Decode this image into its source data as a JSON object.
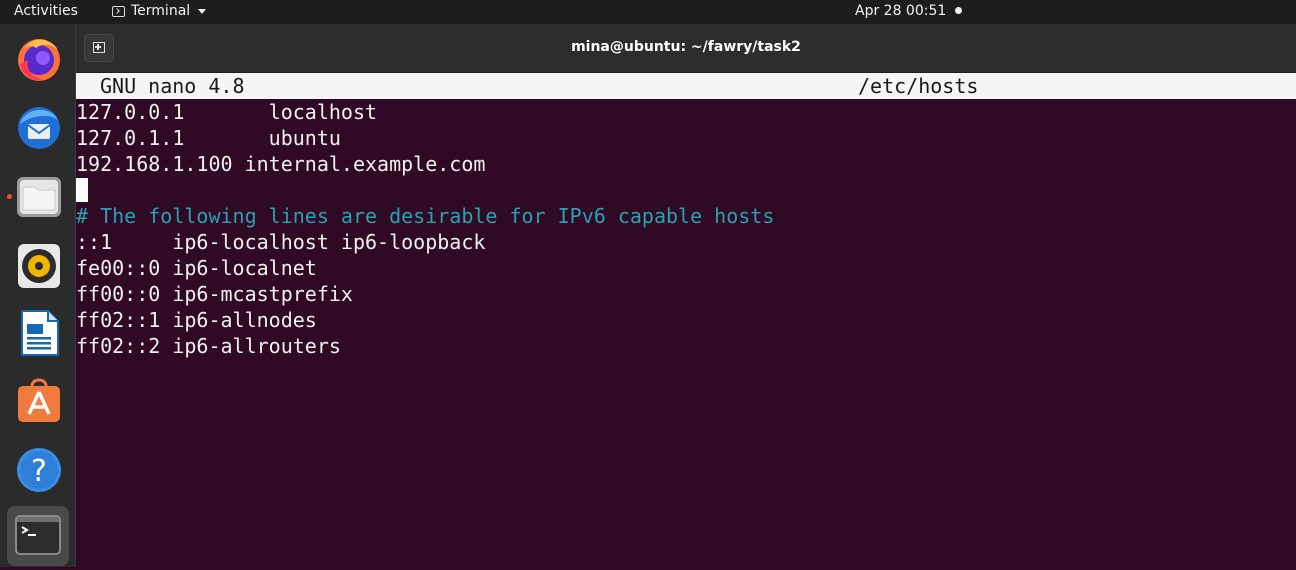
{
  "topbar": {
    "activities": "Activities",
    "app_menu": "Terminal",
    "clock": "Apr 28  00:51"
  },
  "dock": {
    "items": [
      {
        "name": "Firefox",
        "icon": "firefox-icon"
      },
      {
        "name": "Thunderbird",
        "icon": "thunderbird-icon"
      },
      {
        "name": "Files",
        "icon": "files-icon"
      },
      {
        "name": "Rhythmbox",
        "icon": "rhythmbox-icon"
      },
      {
        "name": "LibreOffice Writer",
        "icon": "writer-icon"
      },
      {
        "name": "Ubuntu Software",
        "icon": "software-icon"
      },
      {
        "name": "Help",
        "icon": "help-icon"
      },
      {
        "name": "Terminal",
        "icon": "terminal-icon"
      }
    ]
  },
  "terminal": {
    "title": "mina@ubuntu: ~/fawry/task2"
  },
  "nano": {
    "version": "GNU nano 4.8",
    "filename": "/etc/hosts",
    "lines": [
      "127.0.0.1       localhost",
      "127.0.1.1       ubuntu",
      "192.168.1.100 internal.example.com",
      "",
      "# The following lines are desirable for IPv6 capable hosts",
      "::1     ip6-localhost ip6-loopback",
      "fe00::0 ip6-localnet",
      "ff00::0 ip6-mcastprefix",
      "ff02::1 ip6-allnodes",
      "ff02::2 ip6-allrouters"
    ]
  },
  "colors": {
    "terminal_bg": "#300a24",
    "comment": "#2aa1b3",
    "accent": "#e95420"
  }
}
